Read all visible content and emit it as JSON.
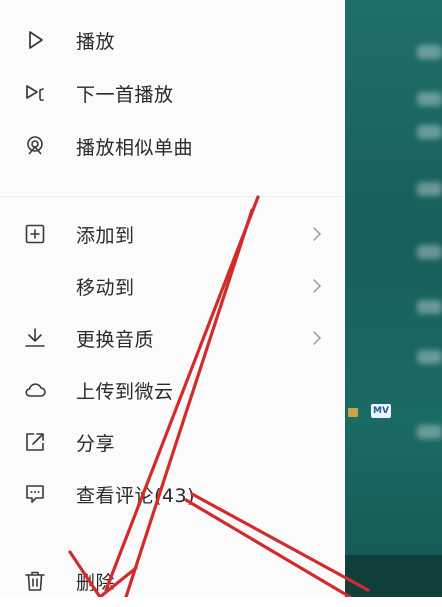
{
  "menu": {
    "items": [
      {
        "label": "播放",
        "icon": "play-icon"
      },
      {
        "label": "下一首播放",
        "icon": "play-next-icon"
      },
      {
        "label": "播放相似单曲",
        "icon": "similar-radio-icon"
      },
      {
        "label": "添加到",
        "icon": "add-box-icon"
      },
      {
        "label": "移动到",
        "icon": ""
      },
      {
        "label": "更换音质",
        "icon": "download-icon"
      },
      {
        "label": "上传到微云",
        "icon": "cloud-icon"
      },
      {
        "label": "分享",
        "icon": "share-icon"
      },
      {
        "label": "查看评论(43)",
        "icon": "comment-icon"
      },
      {
        "label": "删除",
        "icon": "trash-icon"
      }
    ]
  },
  "backdrop": {
    "tag_text": "MV"
  },
  "colors": {
    "menu_bg": "#fbfbfb",
    "text": "#2a2a2a",
    "icon": "#3a3a3a",
    "backdrop": "#1a6b64",
    "annotation_arrow": "#d22b2b"
  }
}
